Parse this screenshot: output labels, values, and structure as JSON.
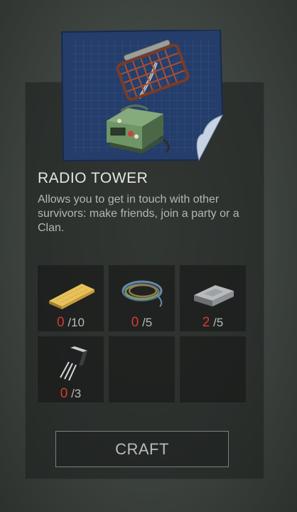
{
  "item": {
    "title": "RADIO TOWER",
    "description": "Allows you to get in touch with other survivors: make friends, join a party or a Clan."
  },
  "requirements": [
    {
      "name": "wood-plank",
      "have": "0",
      "need": "/10"
    },
    {
      "name": "wire-coil",
      "have": "0",
      "need": "/5"
    },
    {
      "name": "metal-ingot",
      "have": "2",
      "need": "/5"
    },
    {
      "name": "transistor",
      "have": "0",
      "need": "/3"
    }
  ],
  "craft_button": {
    "label": "CRAFT"
  },
  "colors": {
    "missing": "#d23c34",
    "text": "#b8bbb7",
    "blueprint": "#253e6b"
  }
}
